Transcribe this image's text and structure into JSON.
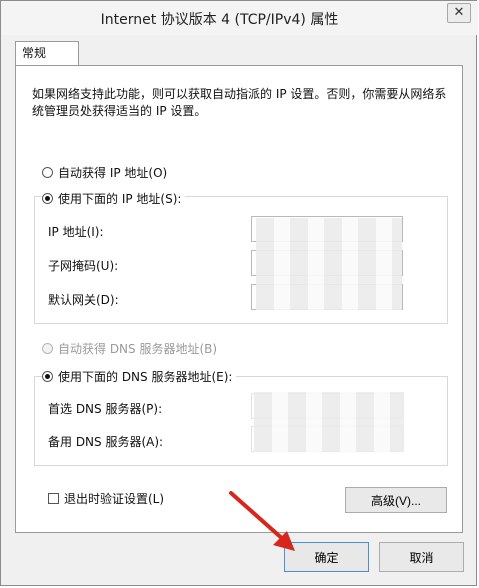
{
  "window": {
    "title": "Internet 协议版本 4 (TCP/IPv4) 属性",
    "close_glyph": "✕"
  },
  "tabs": [
    {
      "label": "常规"
    }
  ],
  "general": {
    "description": "如果网络支持此功能，则可以获取自动指派的 IP 设置。否则，你需要从网络系统管理员处获得适当的 IP 设置。",
    "ip_auto_label": "自动获得 IP 地址(O)",
    "ip_manual_label": "使用下面的 IP 地址(S):",
    "ip_address_label": "IP 地址(I):",
    "subnet_mask_label": "子网掩码(U):",
    "gateway_label": "默认网关(D):",
    "dns_auto_label": "自动获得 DNS 服务器地址(B)",
    "dns_manual_label": "使用下面的 DNS 服务器地址(E):",
    "preferred_dns_label": "首选 DNS 服务器(P):",
    "alternate_dns_label": "备用 DNS 服务器(A):",
    "validate_label": "退出时验证设置(L)",
    "advanced_button": "高级(V)..."
  },
  "footer": {
    "ok_button": "确定",
    "cancel_button": "取消"
  },
  "colors": {
    "annotation_arrow": "#d9261c",
    "default_button_border": "#4a90d0"
  },
  "icons": {
    "close": "close-icon",
    "arrow": "red-arrow-annotation"
  }
}
